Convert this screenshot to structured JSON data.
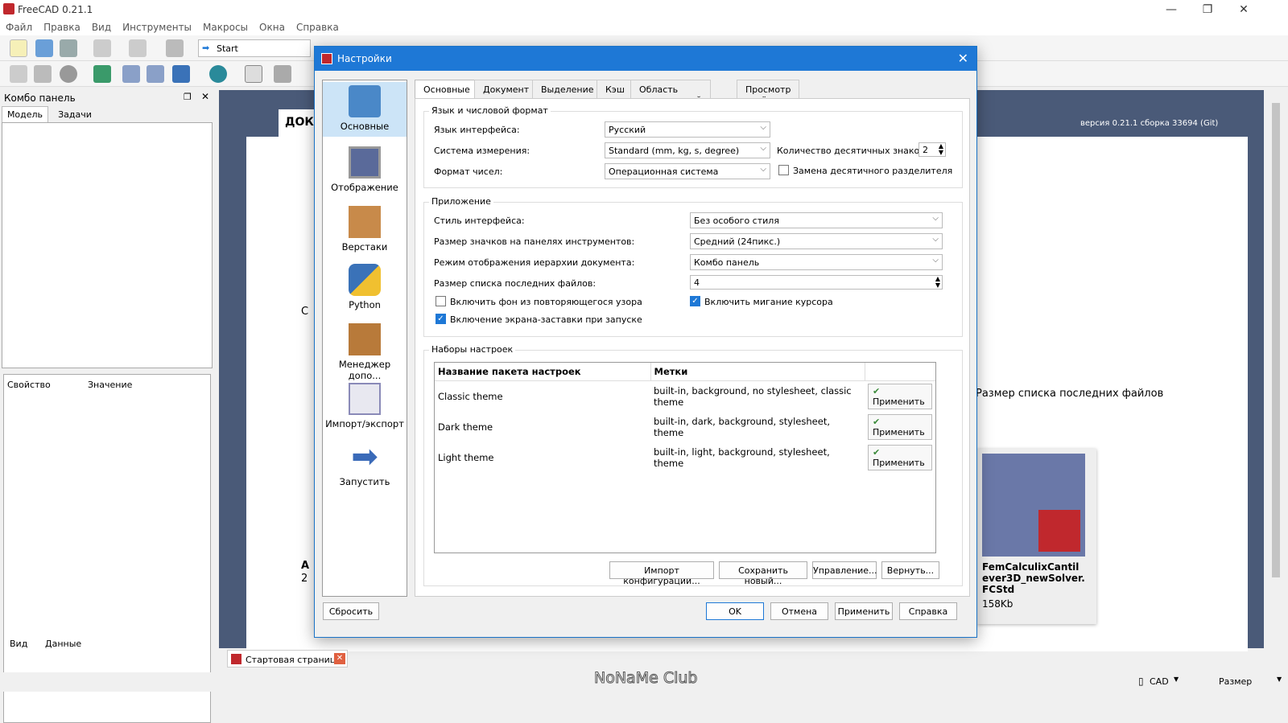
{
  "app": {
    "title": "FreeCAD 0.21.1",
    "minimize": "—",
    "maximize": "❐",
    "close": "✕"
  },
  "menu": [
    "Файл",
    "Правка",
    "Вид",
    "Инструменты",
    "Макросы",
    "Окна",
    "Справка"
  ],
  "toolbar": {
    "workbench": "Start"
  },
  "combo": {
    "title": "Комбо панель",
    "tabs": [
      "Модель",
      "Задачи"
    ],
    "prop_headers": [
      "Свойство",
      "Значение"
    ],
    "bottom_tabs": [
      "Вид",
      "Данные"
    ]
  },
  "startpage": {
    "tab_partial": "ДОК",
    "version": "версия 0.21.1 сборка 33694 (Git)",
    "file_name": "FemCalculixCantilever3D_newSolver.FCStd",
    "file_size": "158Kb",
    "letter_c": "C",
    "letter_a": "A",
    "letter_2": "2",
    "hint": "Размер списка последних файлов"
  },
  "dialog": {
    "title": "Настройки",
    "sidebar": [
      "Основные",
      "Отображение",
      "Верстаки",
      "Python",
      "Менеджер допо...",
      "Импорт/экспорт",
      "Запустить"
    ],
    "tabs": [
      "Основные",
      "Документ",
      "Выделение",
      "Кэш",
      "Область уведомлений",
      "Просмотр отчёта"
    ],
    "lang_group": "Язык и числовой формат",
    "lang_label": "Язык интерфейса:",
    "lang_value": "Русский",
    "units_label": "Система измерения:",
    "units_value": "Standard (mm, kg, s, degree)",
    "decimals_label": "Количество десятичных знаков:",
    "decimals_value": "2",
    "numfmt_label": "Формат чисел:",
    "numfmt_value": "Операционная система",
    "decsep_label": "Замена десятичного разделителя",
    "app_group": "Приложение",
    "style_label": "Стиль интерфейса:",
    "style_value": "Без особого стиля",
    "iconsize_label": "Размер значков на панелях инструментов:",
    "iconsize_value": "Средний (24пикс.)",
    "tree_label": "Режим отображения иерархии документа:",
    "tree_value": "Комбо панель",
    "recent_label": "Размер списка последних файлов:",
    "recent_value": "4",
    "tiled_label": "Включить фон из повторяющегося узора",
    "blink_label": "Включить мигание курсора",
    "splash_label": "Включение экрана-заставки при запуске",
    "packs_group": "Наборы настроек",
    "packs_headers": [
      "Название пакета настроек",
      "Метки"
    ],
    "packs": [
      {
        "name": "Classic theme",
        "tags": "built-in, background, no stylesheet, classic theme",
        "apply": "Применить"
      },
      {
        "name": "Dark theme",
        "tags": "built-in, dark, background, stylesheet, theme",
        "apply": "Применить"
      },
      {
        "name": "Light theme",
        "tags": "built-in, light, background, stylesheet, theme",
        "apply": "Применить"
      }
    ],
    "pack_buttons": [
      "Импорт конфигурации...",
      "Сохранить новый...",
      "Управление...",
      "Вернуть..."
    ],
    "reset": "Сбросить",
    "ok": "OK",
    "cancel": "Отмена",
    "apply": "Применить",
    "help": "Справка"
  },
  "bottom": {
    "start_tab": "Стартовая страница",
    "watermark": "NoNaMe Club",
    "cad": "CAD",
    "size": "Размер"
  },
  "colors": {
    "accent": "#1e78d6",
    "main_bg": "#4a5a78"
  }
}
